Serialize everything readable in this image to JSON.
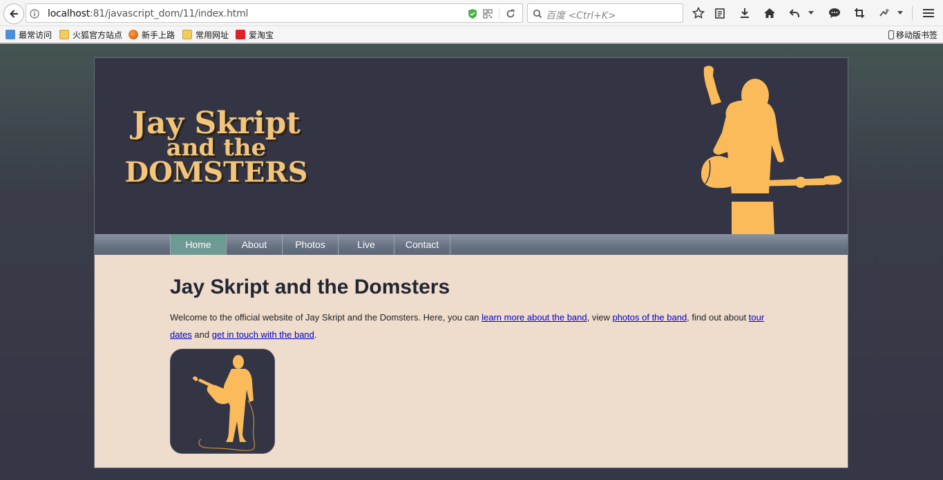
{
  "browser": {
    "url_host": "localhost",
    "url_path": ":81/javascript_dom/11/index.html",
    "search_placeholder": "百度 <Ctrl+K>",
    "bookmarks": [
      {
        "label": "最常访问",
        "icon": "most-visited-icon"
      },
      {
        "label": "火狐官方站点",
        "icon": "folder-icon"
      },
      {
        "label": "新手上路",
        "icon": "firefox-icon"
      },
      {
        "label": "常用网址",
        "icon": "folder-icon"
      },
      {
        "label": "爱淘宝",
        "icon": "taobao-icon"
      }
    ],
    "mobile_bookmarks": "移动版书签"
  },
  "site": {
    "logo_lines": [
      "Jay Skript",
      "and the",
      "DOMSTERS"
    ],
    "nav": [
      {
        "label": "Home",
        "current": true
      },
      {
        "label": "About",
        "current": false
      },
      {
        "label": "Photos",
        "current": false
      },
      {
        "label": "Live",
        "current": false
      },
      {
        "label": "Contact",
        "current": false
      }
    ],
    "title": "Jay Skript and the Domsters",
    "intro": {
      "t1": "Welcome to the official website of Jay Skript and the Domsters. Here, you can ",
      "l1": "learn more about the band",
      "t2": ", view ",
      "l2": "photos of the band",
      "t3": ", find out about ",
      "l3": "tour dates",
      "t4": " and ",
      "l4": "get in touch with the band",
      "t5": "."
    }
  },
  "colors": {
    "header_bg": "#333545",
    "accent": "#fbbb5a",
    "content_bg": "#eedccd",
    "nav_current": "#6e9a94"
  }
}
